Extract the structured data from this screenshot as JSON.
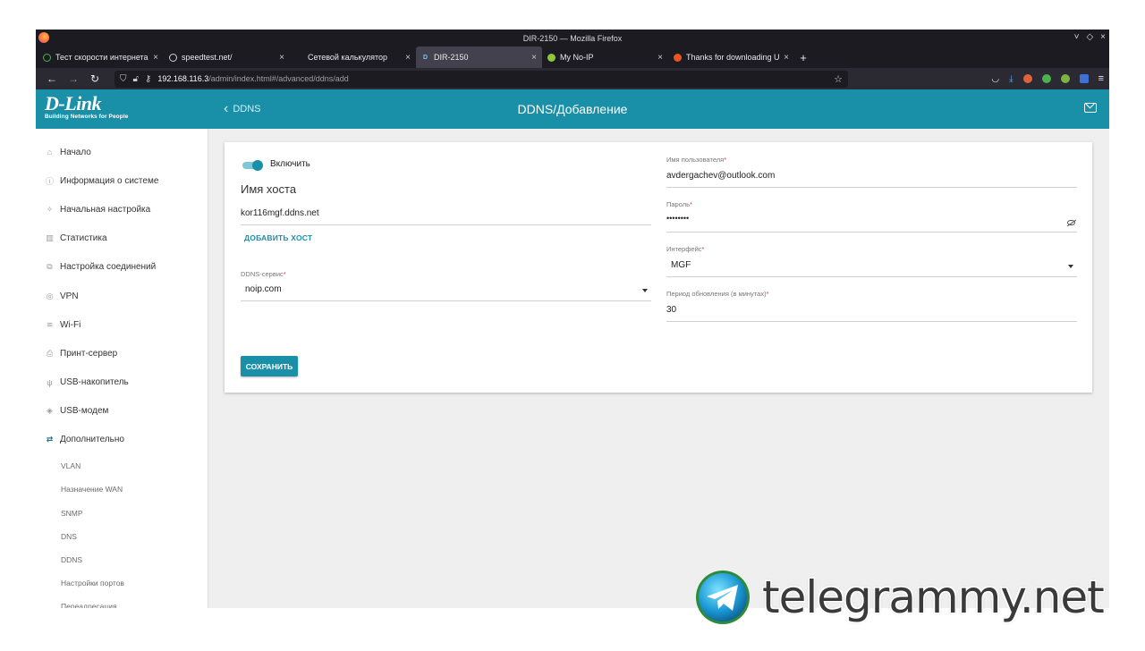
{
  "browser": {
    "window_title": "DIR-2150 — Mozilla Firefox",
    "window_controls": [
      "˅",
      "◇",
      "×"
    ],
    "tabs": [
      {
        "label": "Тест скорости интернета",
        "icon": "speedtest-icon",
        "active": false
      },
      {
        "label": "speedtest.net/",
        "icon": "gauge-icon",
        "active": false
      },
      {
        "label": "Сетевой калькулятор",
        "icon": "",
        "active": false
      },
      {
        "label": "DIR-2150",
        "icon": "dlink-d-icon",
        "active": true
      },
      {
        "label": "My No-IP",
        "icon": "noip-icon",
        "active": false
      },
      {
        "label": "Thanks for downloading U",
        "icon": "ubuntu-icon",
        "active": false
      }
    ],
    "new_tab": "+",
    "url_host": "192.168.116.3",
    "url_path": "/admin/index.html#/advanced/ddns/add"
  },
  "header": {
    "logo_main": "D-Link",
    "logo_sub": "Building Networks for People",
    "back_label": "DDNS",
    "page_title": "DDNS/Добавление"
  },
  "sidebar": {
    "items": [
      {
        "label": "Начало",
        "icon": "home-icon",
        "glyph": "⌂"
      },
      {
        "label": "Информация о системе",
        "icon": "info-icon",
        "glyph": "ⓘ"
      },
      {
        "label": "Начальная настройка",
        "icon": "wand-icon",
        "glyph": "✧"
      },
      {
        "label": "Статистика",
        "icon": "bar-chart-icon",
        "glyph": "▥"
      },
      {
        "label": "Настройка соединений",
        "icon": "connections-icon",
        "glyph": "⧉"
      },
      {
        "label": "VPN",
        "icon": "vpn-icon",
        "glyph": "◎"
      },
      {
        "label": "Wi-Fi",
        "icon": "wifi-icon",
        "glyph": "≋"
      },
      {
        "label": "Принт-сервер",
        "icon": "printer-icon",
        "glyph": "⎙"
      },
      {
        "label": "USB-накопитель",
        "icon": "usb-icon",
        "glyph": "ψ"
      },
      {
        "label": "USB-модем",
        "icon": "modem-icon",
        "glyph": "◈"
      },
      {
        "label": "Дополнительно",
        "icon": "advanced-icon",
        "glyph": "⇄"
      }
    ],
    "subitems": [
      "VLAN",
      "Назначение WAN",
      "SNMP",
      "DNS",
      "DDNS",
      "Настройки портов",
      "Переадресация"
    ]
  },
  "form": {
    "enable_label": "Включить",
    "enabled": true,
    "hosts_title": "Имя хоста",
    "host_value": "kor116mgf.ddns.net",
    "add_host": "ДОБАВИТЬ ХОСТ",
    "ddns_service_label": "DDNS-сервис",
    "ddns_service_value": "noip.com",
    "username_label": "Имя пользователя",
    "username_value": "avdergachev@outlook.com",
    "password_label": "Пароль",
    "password_value": "••••••••",
    "interface_label": "Интерфейс",
    "interface_value": "MGF",
    "period_label": "Период обновления (в минутах)",
    "period_value": "30",
    "required_mark": "*",
    "save_label": "СОХРАНИТЬ"
  },
  "watermark": {
    "text": "telegrammy.net"
  }
}
